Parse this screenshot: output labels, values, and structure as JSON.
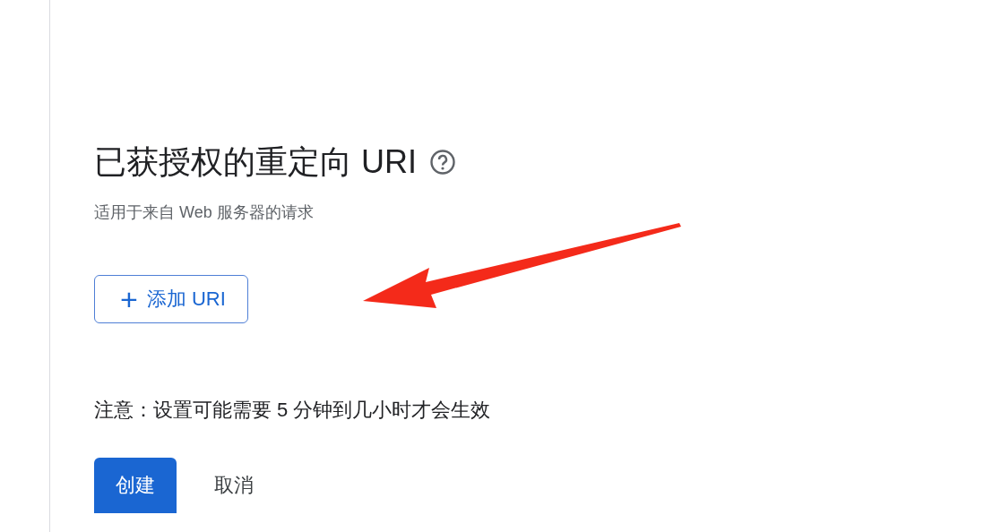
{
  "section": {
    "title": "已获授权的重定向 URI",
    "subtitle": "适用于来自 Web 服务器的请求",
    "add_button": {
      "icon": "+",
      "label": "添加 URI"
    }
  },
  "note": "注意：设置可能需要 5 分钟到几小时才会生效",
  "buttons": [
    {
      "kind": "primary",
      "label": "创建"
    },
    {
      "kind": "text",
      "label": "取消"
    }
  ]
}
